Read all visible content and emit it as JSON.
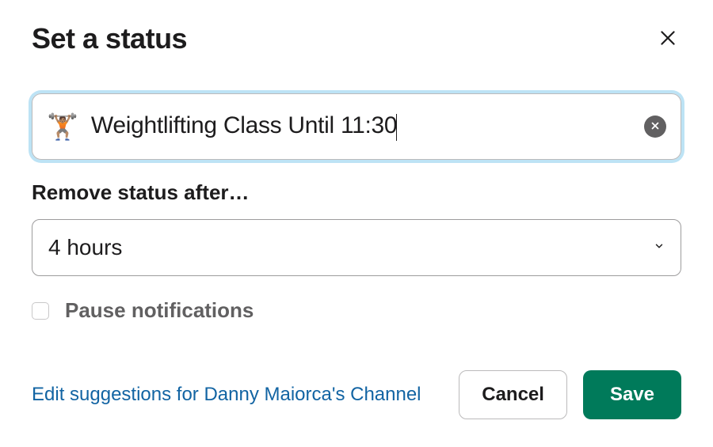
{
  "header": {
    "title": "Set a status"
  },
  "status": {
    "emoji": "🏋🏽",
    "text": "Weightlifting Class Until 11:30"
  },
  "remove_after": {
    "label": "Remove status after…",
    "value": "4 hours"
  },
  "pause": {
    "label": "Pause notifications",
    "checked": false
  },
  "footer": {
    "edit_link": "Edit suggestions for Danny Maiorca's Channel",
    "cancel": "Cancel",
    "save": "Save"
  }
}
